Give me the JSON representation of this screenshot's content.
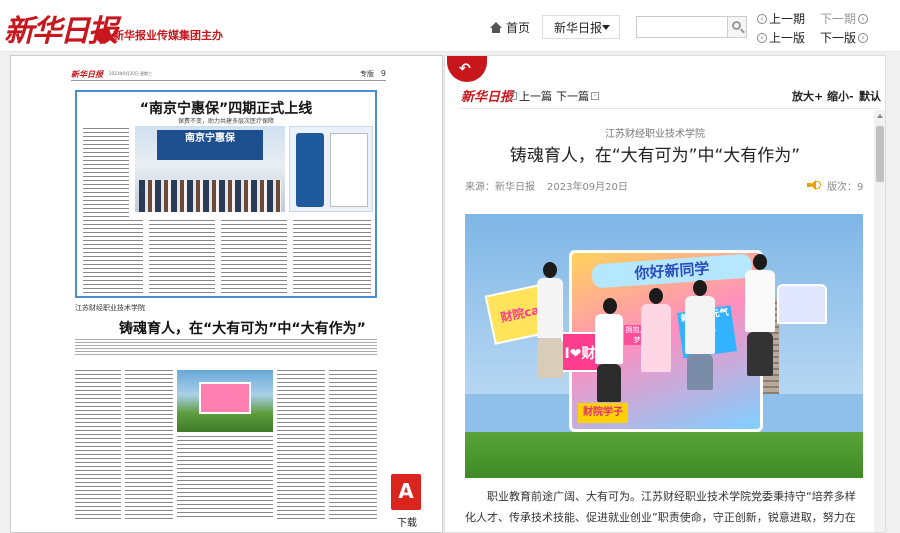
{
  "brand": {
    "name": "新华日报",
    "group": "新华报业传媒集团主办"
  },
  "nav": {
    "home": "首页",
    "paper_select": "新华日报",
    "search_placeholder": "",
    "prev_issue": "上一期",
    "next_issue": "下一期",
    "prev_page": "上一版",
    "next_page": "下一版"
  },
  "left_page": {
    "logo": "新华日报",
    "date_line": "2023年9月20日 星期三",
    "section": "专版",
    "page_no": "9",
    "ad_title": "“南京宁惠保”四期正式上线",
    "ad_subtitle": "保费不变，助力共建多层次医疗保障",
    "screen_text": "南京宁惠保",
    "org": "江苏财经职业技术学院",
    "headline": "铸魂育人，在“大有可为”中“大有作为”"
  },
  "download": {
    "label": "下载"
  },
  "article": {
    "logo": "新华日报",
    "prev": "上一篇",
    "next": "下一篇",
    "zoom_in": "放大+",
    "zoom_out": "缩小-",
    "default": "默认",
    "org": "江苏财经职业技术学院",
    "title": "铸魂育人，在“大有可为”中“大有作为”",
    "source_label": "来源：新华日报",
    "date": "2023年09月20日",
    "edition": "版次：9",
    "photo": {
      "board_title": "你好新同学",
      "sign_left": "财院call",
      "sign_mid": "I❤财院",
      "badge_1": "拥抱人海 逐梦未来",
      "badge_2": "新学期 元气满满",
      "badge_3": "财院学子"
    },
    "paragraph": "职业教育前途广阔、大有可为。江苏财经职业技术学院党委秉持守“培养多样化人才、传承技术技能、促进就业创业”职责使命，守正创新，锐意进取，努力在"
  },
  "colors": {
    "brand_red": "#c8161d",
    "ad_border": "#4a8fd1",
    "speaker": "#e8a000"
  }
}
